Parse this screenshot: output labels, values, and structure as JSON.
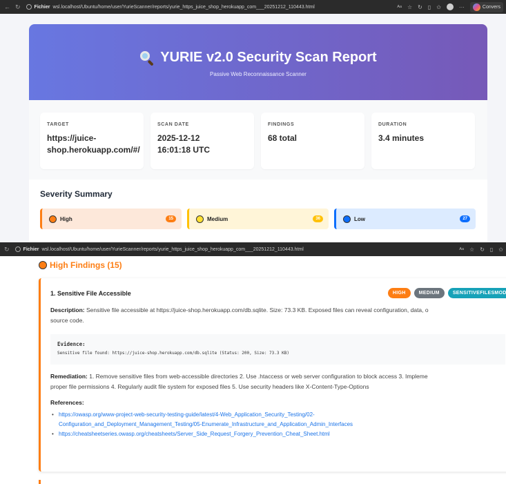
{
  "browser": {
    "site_label": "Fichier",
    "url_top": "wsl.localhost/Ubuntu/home/user/YurieScanner/reports/yurie_https_juice_shop_herokuapp_com___20251212_110443.html",
    "url_bottom": "wsl.localhost/Ubuntu/home/user/YurieScanner/reports/yurie_https_juice_shop_herokuapp_com___20251212_110443.html",
    "copilot_label": "Convers"
  },
  "header": {
    "title": "YURIE v2.0 Security Scan Report",
    "subtitle": "Passive Web Reconnaissance Scanner"
  },
  "stats": [
    {
      "label": "TARGET",
      "value": "https://juice-\nshop.herokuapp.com/#/"
    },
    {
      "label": "SCAN DATE",
      "value": "2025-12-12\n16:01:18 UTC"
    },
    {
      "label": "FINDINGS",
      "value": "68 total"
    },
    {
      "label": "DURATION",
      "value": "3.4 minutes"
    }
  ],
  "severity_summary": {
    "title": "Severity Summary",
    "items": [
      {
        "label": "High",
        "count": "15",
        "color": "#fd7e14"
      },
      {
        "label": "Medium",
        "count": "36",
        "color": "#ffc107"
      },
      {
        "label": "Low",
        "count": "27",
        "color": "#0d6efd"
      }
    ]
  },
  "high_findings": {
    "title": "High Findings (15)",
    "finding": {
      "title": "1. Sensitive File Accessible",
      "badges": [
        "HIGH",
        "MEDIUM",
        "SENSITIVEFILESMODU"
      ],
      "description_label": "Description:",
      "description_line1": "Sensitive file accessible at https://juice-shop.herokuapp.com/db.sqlite. Size: 73.3 KB. Exposed files can reveal configuration, data, o",
      "description_line2": "source code.",
      "evidence_label": "Evidence:",
      "evidence_value": "Sensitive file found: https://juice-shop.herokuapp.com/db.sqlite (Status: 200, Size: 73.3 KB)",
      "remediation_label": "Remediation:",
      "remediation_line1": "1. Remove sensitive files from web-accessible directories 2. Use .htaccess or web server configuration to block access 3. Impleme",
      "remediation_line2": "proper file permissions 4. Regularly audit file system for exposed files 5. Use security headers like X-Content-Type-Options",
      "references_label": "References:",
      "references": [
        "https://owasp.org/www-project-web-security-testing-guide/latest/4-Web_Application_Security_Testing/02-\nConfiguration_and_Deployment_Management_Testing/05-Enumerate_Infrastructure_and_Application_Admin_Interfaces",
        "https://cheatsheetseries.owasp.org/cheatsheets/Server_Side_Request_Forgery_Prevention_Cheat_Sheet.html"
      ]
    }
  }
}
